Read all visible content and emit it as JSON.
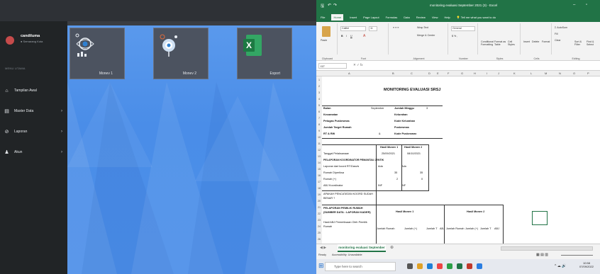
{
  "app": {
    "user": {
      "name": "candiluma",
      "status": "Semarang Kota"
    },
    "section_label": "MENU UTAMA",
    "nav": [
      {
        "label": "Tampilan Awal",
        "icon": "home-icon",
        "has_children": false
      },
      {
        "label": "Master Data",
        "icon": "database-icon",
        "has_children": true
      },
      {
        "label": "Laporan",
        "icon": "report-icon",
        "has_children": true
      },
      {
        "label": "Akun",
        "icon": "user-icon",
        "has_children": true
      }
    ],
    "tiles": [
      {
        "label": "Monev 1",
        "icon": "monitoring-eye-icon"
      },
      {
        "label": "Monev 2",
        "icon": "monitoring-target-icon"
      },
      {
        "label": "Export",
        "icon": "excel-icon"
      }
    ]
  },
  "excel": {
    "title": "monitoring evaluasi September 2021 (3) - Excel",
    "menu_tabs": [
      "File",
      "Home",
      "Insert",
      "Page Layout",
      "Formulas",
      "Data",
      "Review",
      "View",
      "Help",
      "Tell me what you want to do"
    ],
    "active_tab": "Home",
    "ribbon": {
      "paste": "Paste",
      "font_name": "Calibri",
      "font_size": "11",
      "wrap_text": "Wrap Text",
      "merge": "Merge & Center",
      "number_format": "General",
      "conditional": "Conditional Formatting",
      "format_table": "Format as Table",
      "cell_styles": "Cell Styles",
      "insert": "Insert",
      "delete": "Delete",
      "format": "Format",
      "autosum": "AutoSum",
      "fill": "Fill",
      "clear": "Clear",
      "sort": "Sort & Filter",
      "find": "Find & Select",
      "groups": [
        "Clipboard",
        "Font",
        "Alignment",
        "Number",
        "Styles",
        "Cells",
        "Editing"
      ]
    },
    "name_box": "I17",
    "columns": [
      "A",
      "B",
      "C",
      "D",
      "E",
      "F",
      "G",
      "H",
      "I",
      "J",
      "K",
      "L",
      "M",
      "N",
      "O",
      "P"
    ],
    "sheet_title": "MONITORING EVALUASI SRSJ",
    "cells": {
      "r4a": "Bulan",
      "r4b": "September",
      "r4c": "Jumlah Minggu",
      "r4e": "3",
      "r5a": "Kecamatan",
      "r5c": "Kelurahan",
      "r6a": "Petugas Puskesmas",
      "r6c": "Kode Kelurahan",
      "r7a": "Jumlah Target Rumah",
      "r7c": "Puskesmas",
      "r8a": "RT & RW",
      "r8b": "&",
      "r8c": "Kode Puskesmas",
      "r9b": "Hasil Monev 1",
      "r9c": "Hasil Monev 2",
      "r10a": "Tanggal Pelaksanaan",
      "r10b": "25/09/2021",
      "r10c": "08/10/2021",
      "r11a": "PELAPORAN KOORDINATOR PEMANTAU JENTIK",
      "r12a": "Laporan dari koord RT/Dasvis",
      "r12b": "Ada",
      "r12c": "Ada",
      "r13a": "Rumah Diperiksa",
      "r13b": "35",
      "r13c": "35",
      "r14a": "Rumah (+)",
      "r14b": "2",
      "r14c": "0",
      "r15a": "ABJ Koordinator",
      "r15b": "INF",
      "r15c": "INF",
      "r16a": "APAKAH PENCATATAN KOORD SUDAH BENAR ?",
      "r17a": "PELAPORAN PEMILIK RUMAH (SUMBER DATA : LAPORAN KADER)",
      "r17b": "Hasil Monev 1",
      "r17f": "Hasil Monev 2",
      "r18a": "Hasil ABJ Pemeriksaan Oleh Pemilik Rumah",
      "r18b": "Jumlah Rumah",
      "r18c": "Jumlah (+)",
      "r18d": "Jumlah T",
      "r18e": "ABJ",
      "r18f": "Jumlah Rumah",
      "r18g": "Jumlah (+)",
      "r18h": "Jumlah T",
      "r18i": "ABJ"
    },
    "sheet_tab": "monitoring evaluasi September 2",
    "status_ready": "Ready",
    "status_access": "Accessibility: Unavailable",
    "taskbar_search": "Type here to search",
    "clock_time": "10:58",
    "clock_date": "07/09/2022"
  }
}
